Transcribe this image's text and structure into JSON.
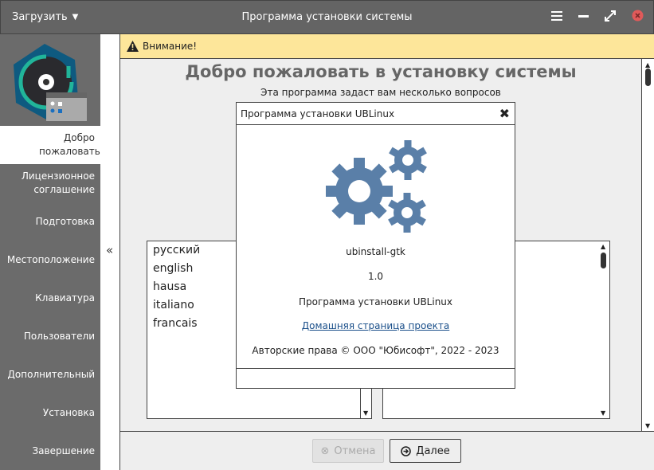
{
  "titlebar": {
    "load_menu": "Загрузить",
    "title": "Программа установки системы"
  },
  "sidebar": {
    "items": [
      {
        "label": "Добро пожаловать"
      },
      {
        "label": "Лицензионное соглашение"
      },
      {
        "label": "Подготовка"
      },
      {
        "label": "Местоположение"
      },
      {
        "label": "Клавиатура"
      },
      {
        "label": "Пользователи"
      },
      {
        "label": "Дополнительный"
      },
      {
        "label": "Установка"
      },
      {
        "label": "Завершение"
      }
    ],
    "collapse": "«"
  },
  "warning": {
    "text": "Внимание!"
  },
  "main": {
    "title": "Добро пожаловать в установку системы",
    "subtitle": "Эта программа задаст вам несколько вопросов",
    "languages": [
      "русский",
      "english",
      "hausa",
      "italiano",
      "francais"
    ]
  },
  "footer": {
    "cancel": "Отмена",
    "next": "Далее"
  },
  "about": {
    "title": "Программа установки UBLinux",
    "program": "ubinstall-gtk",
    "version": "1.0",
    "comment": "Программа установки UBLinux",
    "website": "Домашняя страница проекта",
    "copyright": "Авторские права © ООО \"Юбисофт\", 2022 - 2023"
  },
  "colors": {
    "titlebar": "#646464",
    "sidebar": "#6b6b6b",
    "warning": "#fde69a",
    "gear": "#5a7fa8",
    "close": "#e05a5a",
    "link": "#1a4f8a"
  }
}
